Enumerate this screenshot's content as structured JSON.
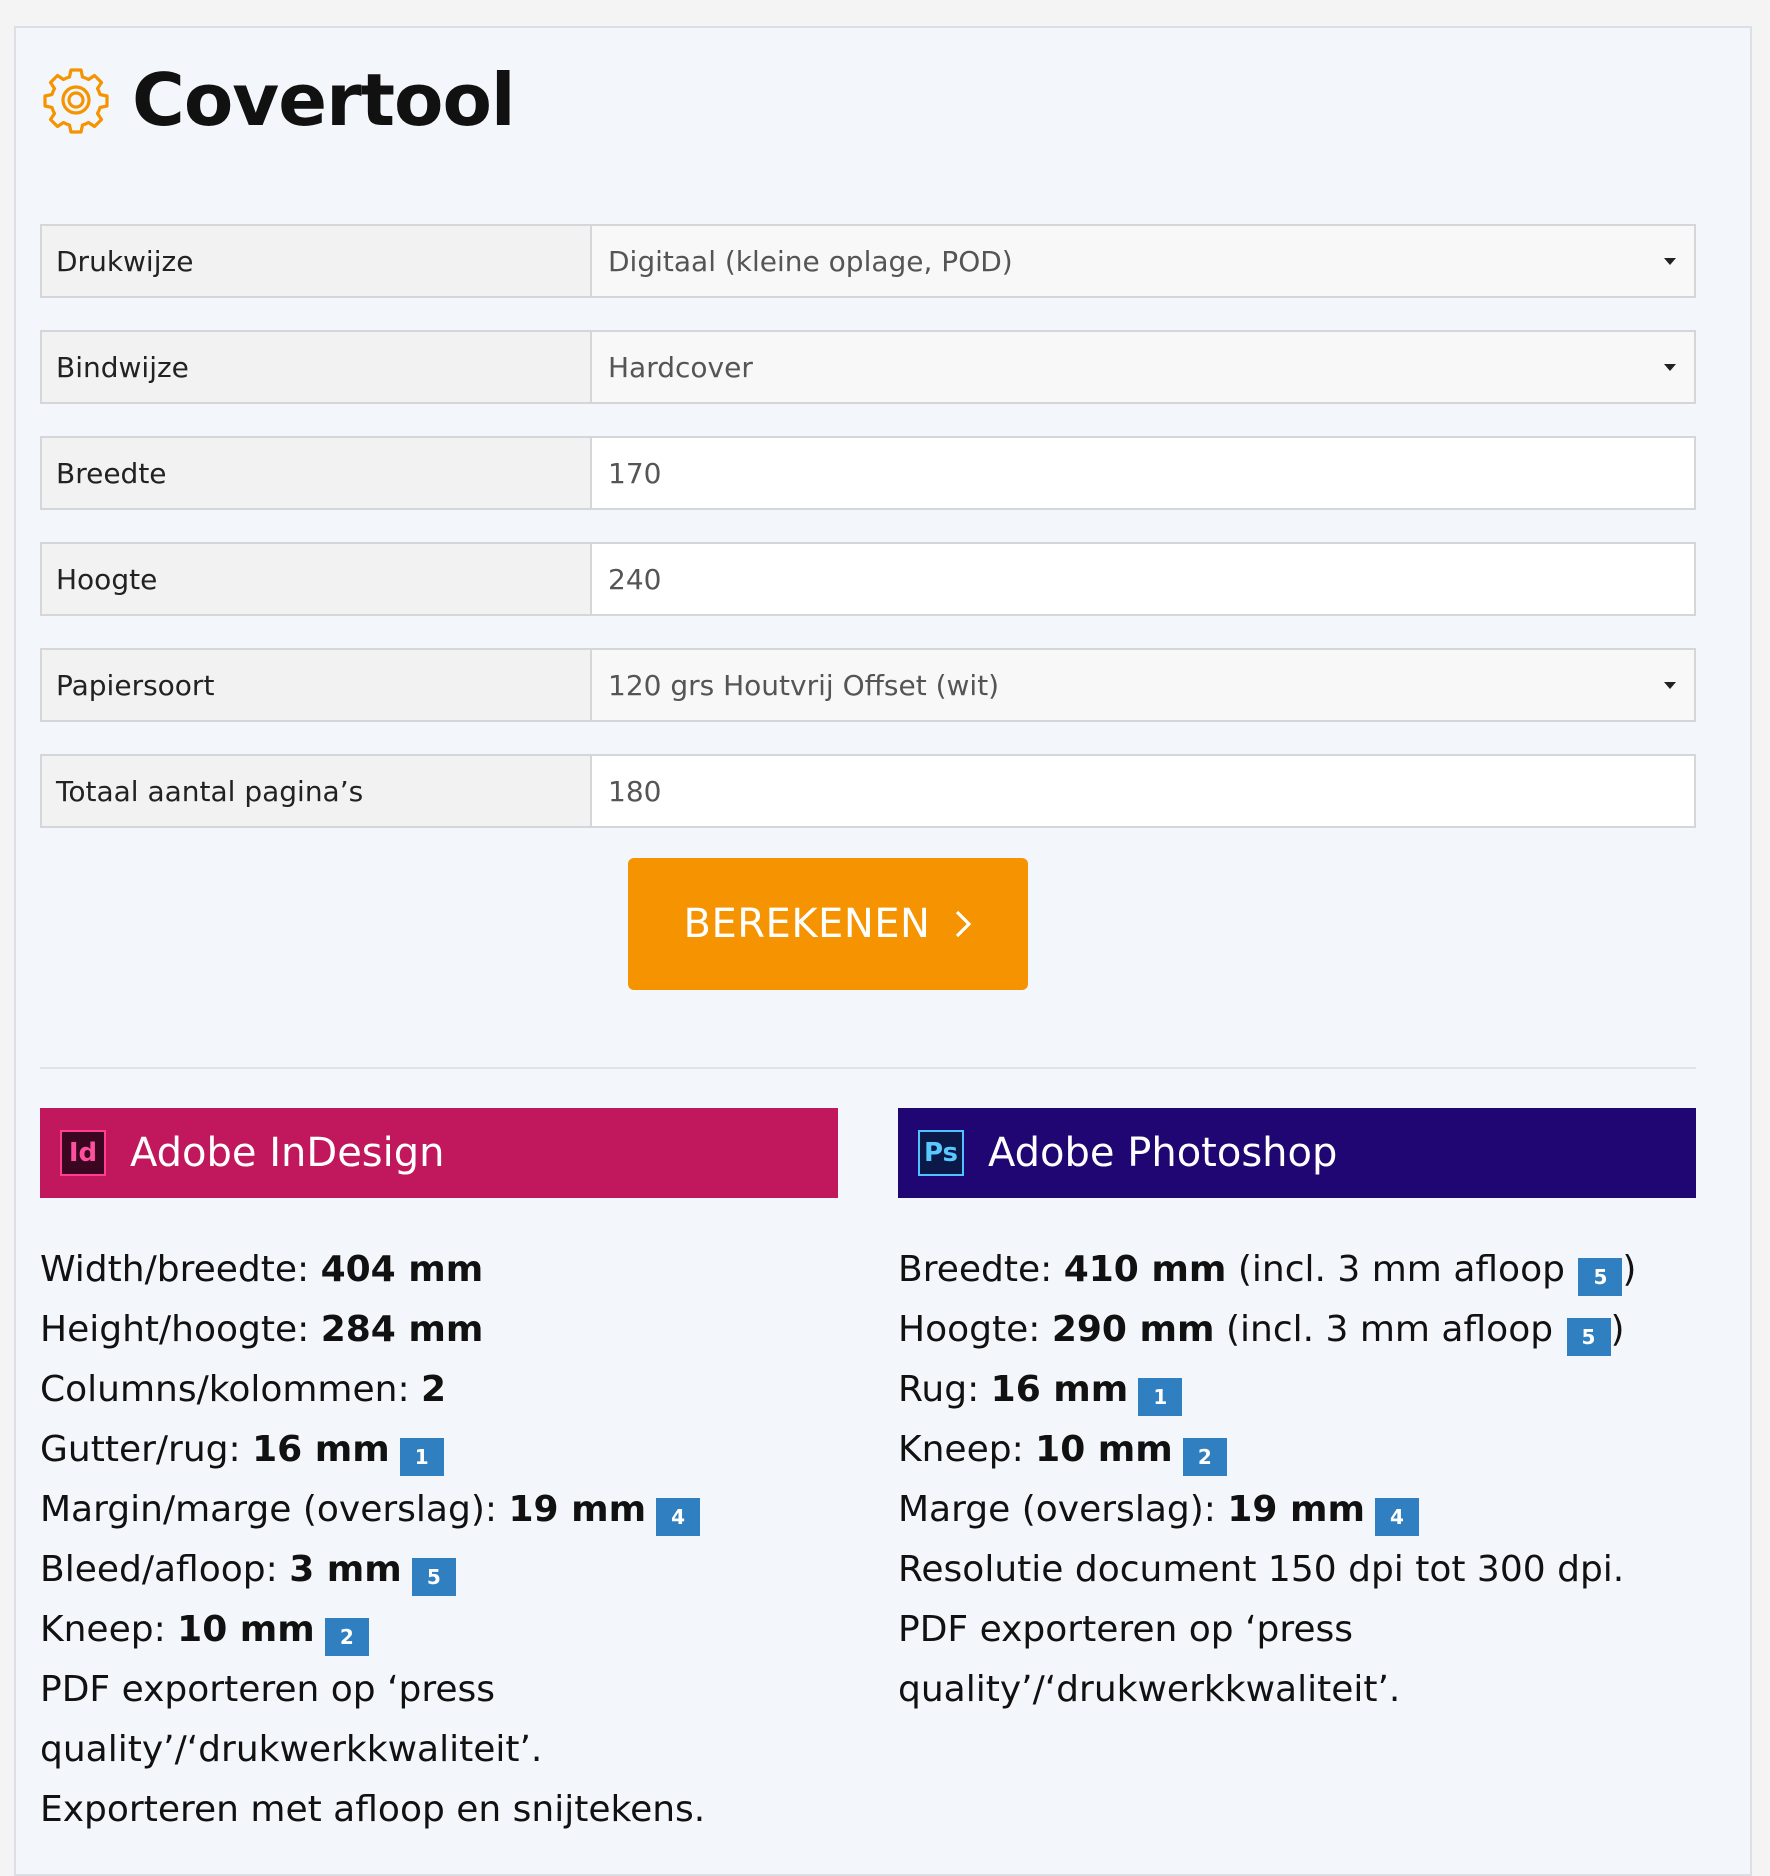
{
  "app": {
    "title": "Covertool",
    "icon": "gear-icon",
    "accent_color": "#f59300"
  },
  "form": {
    "rows": [
      {
        "label": "Drukwijze",
        "value": "Digitaal (kleine oplage, POD)",
        "type": "select"
      },
      {
        "label": "Bindwijze",
        "value": "Hardcover",
        "type": "select"
      },
      {
        "label": "Breedte",
        "value": "170",
        "type": "input"
      },
      {
        "label": "Hoogte",
        "value": "240",
        "type": "input"
      },
      {
        "label": "Papiersoort",
        "value": "120 grs Houtvrij Offset (wit)",
        "type": "select"
      },
      {
        "label": "Totaal aantal pagina’s",
        "value": "180",
        "type": "input"
      }
    ],
    "submit_label": "BEREKENEN",
    "submit_icon": "chevron-right-icon"
  },
  "indesign": {
    "title": "Adobe InDesign",
    "icon_text": "Id",
    "color": "#c1185d",
    "lines": [
      {
        "label": "Width/breedte: ",
        "value": "404 mm",
        "badge": ""
      },
      {
        "label": "Height/hoogte: ",
        "value": "284 mm",
        "badge": ""
      },
      {
        "label": "Columns/kolommen: ",
        "value": "2",
        "badge": ""
      },
      {
        "label": "Gutter/rug: ",
        "value": "16 mm",
        "badge": "1"
      },
      {
        "label": "Margin/marge (overslag): ",
        "value": "19 mm",
        "badge": "4"
      },
      {
        "label": "Bleed/afloop: ",
        "value": "3 mm",
        "badge": "5"
      },
      {
        "label": "Kneep: ",
        "value": "10 mm",
        "badge": "2"
      }
    ],
    "export_note": "PDF exporteren op ‘press quality’/‘drukwerkkwaliteit’.",
    "export_note_2": "Exporteren met afloop en snijtekens."
  },
  "photoshop": {
    "title": "Adobe Photoshop",
    "icon_text": "Ps",
    "color": "#1f0673",
    "breedte_label": "Breedte: ",
    "breedte_value": "410 mm",
    "breedte_suffix": " (incl. 3 mm afloop ",
    "breedte_badge": "5",
    "hoogte_label": "Hoogte: ",
    "hoogte_value": "290 mm",
    "hoogte_suffix": " (incl. 3 mm afloop ",
    "hoogte_badge": "5",
    "close_paren": ")",
    "lines": [
      {
        "label": "Rug: ",
        "value": "16 mm",
        "badge": "1"
      },
      {
        "label": "Kneep: ",
        "value": "10 mm",
        "badge": "2"
      },
      {
        "label": "Marge (overslag): ",
        "value": "19 mm",
        "badge": "4"
      }
    ],
    "resolution_note": "Resolutie document 150 dpi tot 300 dpi.",
    "export_note": "PDF exporteren op ‘press quality’/‘drukwerkkwaliteit’."
  }
}
